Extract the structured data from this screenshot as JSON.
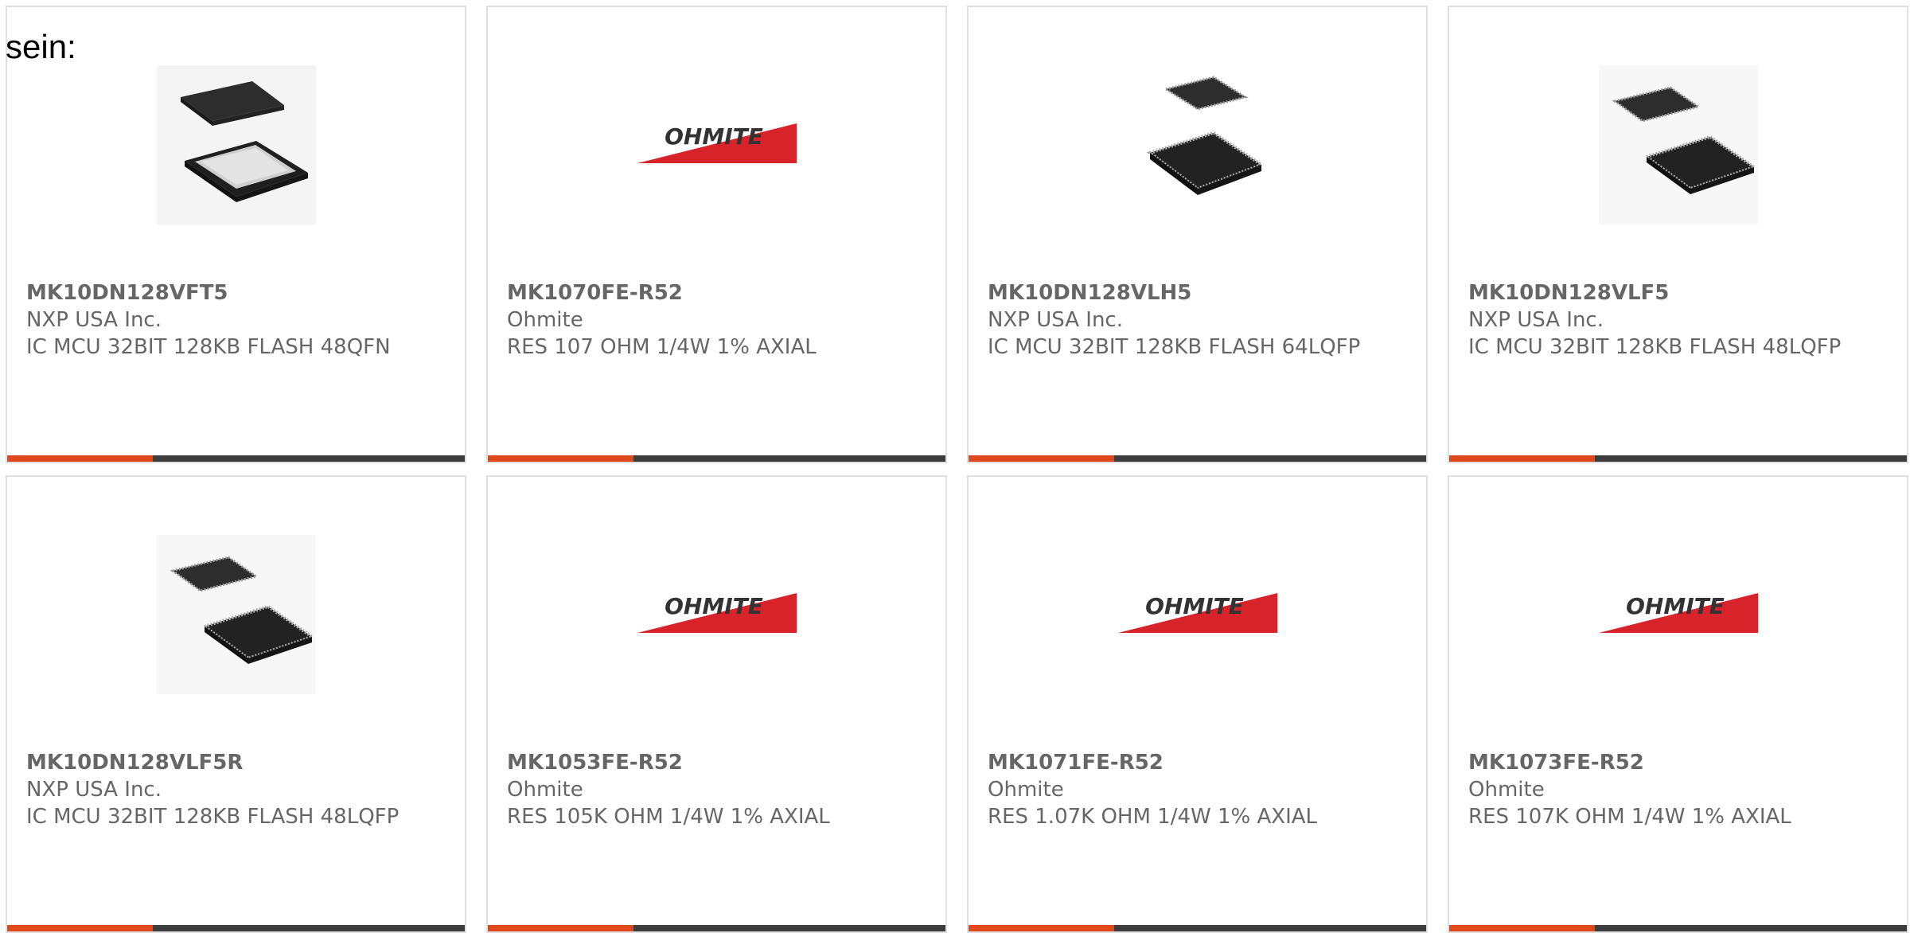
{
  "intro_text": "sein:",
  "colors": {
    "accent": "#e0471a",
    "bar_dark": "#3c3c3c",
    "card_border": "#e0e0e0",
    "text_gray": "#666666",
    "ohmite_red": "#d8232a"
  },
  "products": [
    {
      "part_number": "MK10DN128VFT5",
      "manufacturer": "NXP USA Inc.",
      "description": "IC MCU 32BIT 128KB FLASH 48QFN",
      "image": "qfn-chip-icon"
    },
    {
      "part_number": "MK1070FE-R52",
      "manufacturer": "Ohmite",
      "description": "RES 107 OHM 1/4W 1% AXIAL",
      "image": "ohmite-logo",
      "logo_text": "OHMITE"
    },
    {
      "part_number": "MK10DN128VLH5",
      "manufacturer": "NXP USA Inc.",
      "description": "IC MCU 32BIT 128KB FLASH 64LQFP",
      "image": "lqfp-chip-icon"
    },
    {
      "part_number": "MK10DN128VLF5",
      "manufacturer": "NXP USA Inc.",
      "description": "IC MCU 32BIT 128KB FLASH 48LQFP",
      "image": "lqfp-chip-icon"
    },
    {
      "part_number": "MK10DN128VLF5R",
      "manufacturer": "NXP USA Inc.",
      "description": "IC MCU 32BIT 128KB FLASH 48LQFP",
      "image": "lqfp-chip-icon"
    },
    {
      "part_number": "MK1053FE-R52",
      "manufacturer": "Ohmite",
      "description": "RES 105K OHM 1/4W 1% AXIAL",
      "image": "ohmite-logo",
      "logo_text": "OHMITE"
    },
    {
      "part_number": "MK1071FE-R52",
      "manufacturer": "Ohmite",
      "description": "RES 1.07K OHM 1/4W 1% AXIAL",
      "image": "ohmite-logo",
      "logo_text": "OHMITE"
    },
    {
      "part_number": "MK1073FE-R52",
      "manufacturer": "Ohmite",
      "description": "RES 107K OHM 1/4W 1% AXIAL",
      "image": "ohmite-logo",
      "logo_text": "OHMITE"
    }
  ]
}
